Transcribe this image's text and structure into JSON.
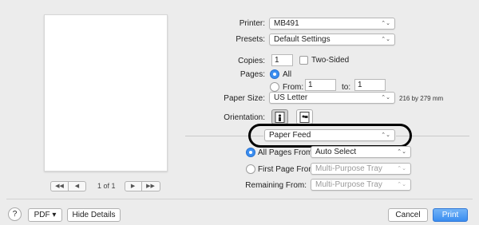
{
  "preview": {
    "page_indicator": "1 of 1",
    "first_icon": "◀◀",
    "prev_icon": "◀",
    "next_icon": "▶",
    "last_icon": "▶▶"
  },
  "printer": {
    "label": "Printer:",
    "value": "MB491"
  },
  "presets": {
    "label": "Presets:",
    "value": "Default Settings"
  },
  "copies": {
    "label": "Copies:",
    "value": "1",
    "two_sided_label": "Two-Sided"
  },
  "pages": {
    "label": "Pages:",
    "all_label": "All",
    "from_label": "From:",
    "from_value": "1",
    "to_label": "to:",
    "to_value": "1"
  },
  "paper_size": {
    "label": "Paper Size:",
    "value": "US Letter",
    "dimensions": "216 by 279 mm"
  },
  "orientation": {
    "label": "Orientation:"
  },
  "section_popup": {
    "value": "Paper Feed"
  },
  "paper_feed": {
    "all_pages_from_label": "All Pages From:",
    "all_pages_from_value": "Auto Select",
    "first_page_from_label": "First Page From:",
    "first_page_from_value": "Multi-Purpose Tray",
    "remaining_from_label": "Remaining From:",
    "remaining_from_value": "Multi-Purpose Tray"
  },
  "bottom": {
    "help_label": "?",
    "pdf_label": "PDF ▾",
    "hide_details_label": "Hide Details",
    "cancel_label": "Cancel",
    "print_label": "Print"
  },
  "colors": {
    "accent": "#3a8df0",
    "annotation": "#000000"
  },
  "popup_arrow": "⌃⌄"
}
